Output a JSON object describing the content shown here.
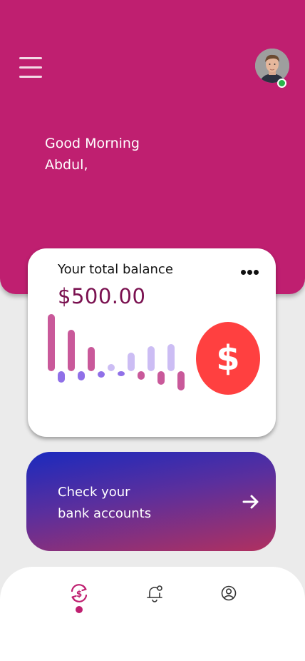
{
  "header": {
    "greeting_line1": "Good Morning",
    "greeting_line2": "Abdul,",
    "menu_icon": "hamburger-icon",
    "avatar_icon": "user-avatar",
    "status": "online",
    "colors": {
      "background": "#bf1f70",
      "status_dot": "#29b34a"
    }
  },
  "balance_card": {
    "title": "Your total balance",
    "amount": "$500.00",
    "more_icon": "more-dots-icon",
    "currency_icon": "dollar-icon",
    "currency_symbol": "$",
    "colors": {
      "amount": "#7a1150",
      "circle": "#ff4040"
    }
  },
  "chart_data": {
    "type": "bar",
    "series": [
      {
        "values": [
          80,
          -16,
          58,
          -13,
          34,
          -9,
          10,
          -7,
          26,
          -12,
          35,
          -19,
          38,
          -27
        ]
      }
    ],
    "colors": [
      "#c9599a",
      "#9070e8",
      "#c9599a",
      "#9070e8",
      "#c9599a",
      "#9070e8",
      "#ccbdf4",
      "#9070e8",
      "#ccbdf4",
      "#c9599a",
      "#ccbdf4",
      "#c9599a",
      "#ccbdf4",
      "#c9599a"
    ]
  },
  "bank_card": {
    "line1": "Check your",
    "line2": "bank accounts",
    "arrow_icon": "arrow-right-icon",
    "colors": {
      "gradient_start": "#1a2abe",
      "gradient_end": "#b1305f"
    }
  },
  "bottom_nav": {
    "items": [
      {
        "icon": "dollar-refresh-icon",
        "active": true
      },
      {
        "icon": "notification-bell-icon",
        "active": false
      },
      {
        "icon": "profile-icon",
        "active": false
      }
    ],
    "colors": {
      "active": "#bf1f70",
      "inactive": "#333333"
    }
  }
}
